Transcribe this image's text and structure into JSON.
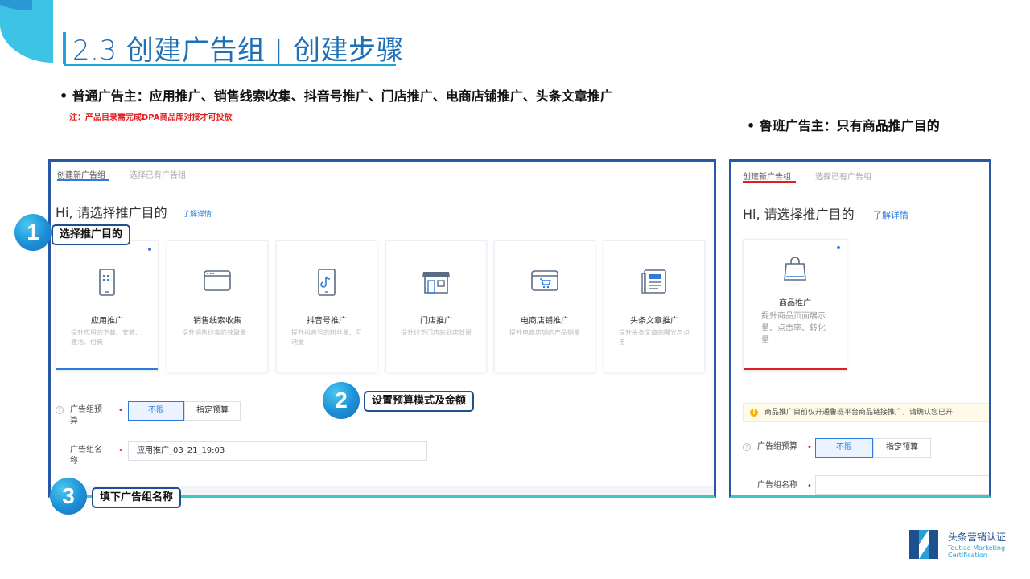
{
  "slide": {
    "title": "2.3 创建广告组 | 创建步骤",
    "bullet_left": "• 普通广告主：应用推广、销售线索收集、抖音号推广、门店推广、电商店铺推广、头条文章推广",
    "note": "注：产品目录需完成DPA商品库对接才可投放",
    "bullet_right": "• 鲁班广告主：只有商品推广目的"
  },
  "left_panel": {
    "tabs": [
      "创建新广告组",
      "选择已有广告组"
    ],
    "greeting": "Hi, 请选择推广目的",
    "detail_link": "了解详情",
    "cards": [
      {
        "title": "应用推广",
        "desc": "提升应用的下载、安装、激活、付费",
        "icon": "phone-app-icon",
        "selected": true
      },
      {
        "title": "销售线索收集",
        "desc": "提升销售线索的获取量",
        "icon": "browser-window-icon",
        "selected": false
      },
      {
        "title": "抖音号推广",
        "desc": "提升抖音号的粉丝量、互动量",
        "icon": "douyin-phone-icon",
        "selected": false
      },
      {
        "title": "门店推广",
        "desc": "提升线下门店的到店效果",
        "icon": "storefront-icon",
        "selected": false
      },
      {
        "title": "电商店铺推广",
        "desc": "提升电商店铺的产品销量",
        "icon": "shop-cart-icon",
        "selected": false
      },
      {
        "title": "头条文章推广",
        "desc": "提升头条文章的曝光与点击",
        "icon": "article-icon",
        "selected": false
      }
    ],
    "budget_label": "广告组预算",
    "budget_options": [
      "不限",
      "指定预算"
    ],
    "name_label": "广告组名称",
    "name_value": "应用推广_03_21_19:03"
  },
  "right_panel": {
    "tabs": [
      "创建新广告组",
      "选择已有广告组"
    ],
    "greeting": "Hi, 请选择推广目的",
    "detail_link": "了解详情",
    "card": {
      "title": "商品推广",
      "desc": "提升商品页面展示量、点击率、转化量",
      "icon": "shopping-bag-icon"
    },
    "warning": "商品推广目前仅开通鲁班平台商品链接推广，请确认您已开",
    "budget_label": "广告组预算",
    "budget_options": [
      "不限",
      "指定预算"
    ],
    "name_label": "广告组名称"
  },
  "steps": [
    {
      "number": "1",
      "label": "选择推广目的"
    },
    {
      "number": "2",
      "label": "设置预算模式及金额"
    },
    {
      "number": "3",
      "label": "填下广告组名称"
    }
  ],
  "brand": {
    "name_cn": "头条营销认证",
    "name_en_1": "Toutiao Marketing",
    "name_en_2": "Certification"
  },
  "colors": {
    "title_blue": "#1e6fb5",
    "frame_blue": "#2857a6",
    "frame_teal": "#3cc7c3",
    "link_blue": "#2e7be0",
    "alert_red": "#e02020"
  }
}
